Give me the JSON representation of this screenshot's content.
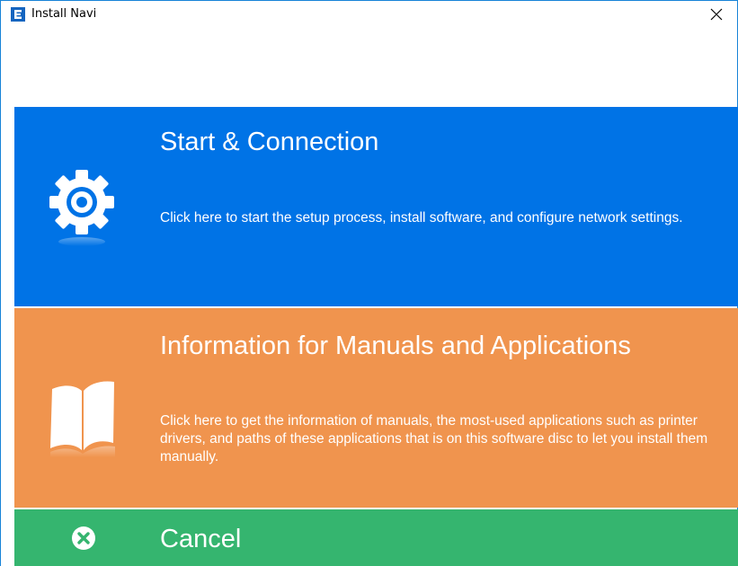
{
  "window": {
    "title": "Install Navi",
    "app_icon": "app-logo-icon",
    "close_icon": "close-icon"
  },
  "panels": {
    "start": {
      "title": "Start & Connection",
      "description": "Click here to start the setup process, install software, and configure network settings.",
      "icon": "gear-icon",
      "color": "#0073e6"
    },
    "info": {
      "title": "Information for Manuals and Applications",
      "description": "Click here to get the information of manuals, the most-used applications such as printer drivers, and paths of these applications that is on this software disc to let you install them manually.",
      "icon": "open-book-icon",
      "color": "#f0944e"
    },
    "cancel": {
      "title": "Cancel",
      "icon": "cancel-circle-icon",
      "color": "#35b56f"
    }
  }
}
